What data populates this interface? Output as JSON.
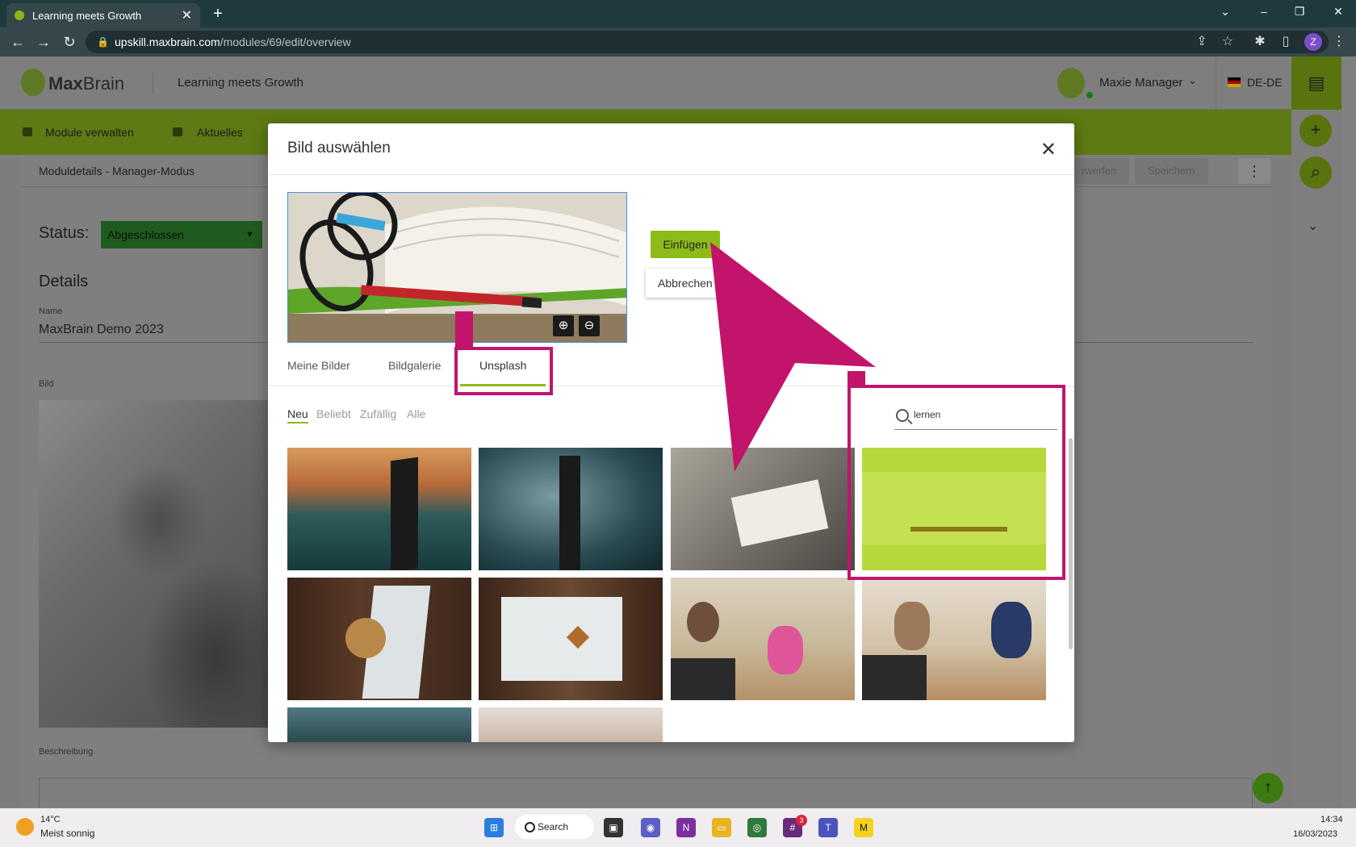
{
  "browser": {
    "tab_title": "Learning meets Growth",
    "url_host": "upskill.maxbrain.com",
    "url_path": "/modules/69/edit/overview",
    "profile_initial": "Z"
  },
  "app": {
    "logo_bold": "Max",
    "logo_light": "Brain",
    "header_title": "Learning meets Growth",
    "user_name": "Maxie Manager",
    "language": "DE-DE",
    "nav": {
      "manage_modules": "Module verwalten",
      "news": "Aktuelles"
    },
    "toolbar": {
      "title": "Moduldetails - Manager-Modus",
      "discard": "rwerfen",
      "save": "Speichern"
    },
    "status_label": "Status:",
    "status_value": "Abgeschlossen",
    "details_heading": "Details",
    "name_label": "Name",
    "name_value": "MaxBrain Demo 2023",
    "image_label": "Bild",
    "description_label": "Beschreibung"
  },
  "modal": {
    "title": "Bild auswählen",
    "insert_button": "Einfügen",
    "cancel_button": "Abbrechen",
    "tabs": [
      "Meine Bilder",
      "Bildgalerie",
      "Unsplash"
    ],
    "active_tab": "Unsplash",
    "filters": [
      "Neu",
      "Beliebt",
      "Zufällig",
      "Alle"
    ],
    "active_filter": "Neu",
    "search_value": "lernen"
  },
  "annotation": {
    "color": "#c2146b"
  },
  "taskbar": {
    "temperature": "14°C",
    "weather": "Meist sonnig",
    "search_label": "Search",
    "notification_count": "3",
    "time": "14:34",
    "date": "16/03/2023"
  },
  "colors": {
    "brand_green": "#8dbb19",
    "active_tab_underline": "#8dbb19"
  }
}
